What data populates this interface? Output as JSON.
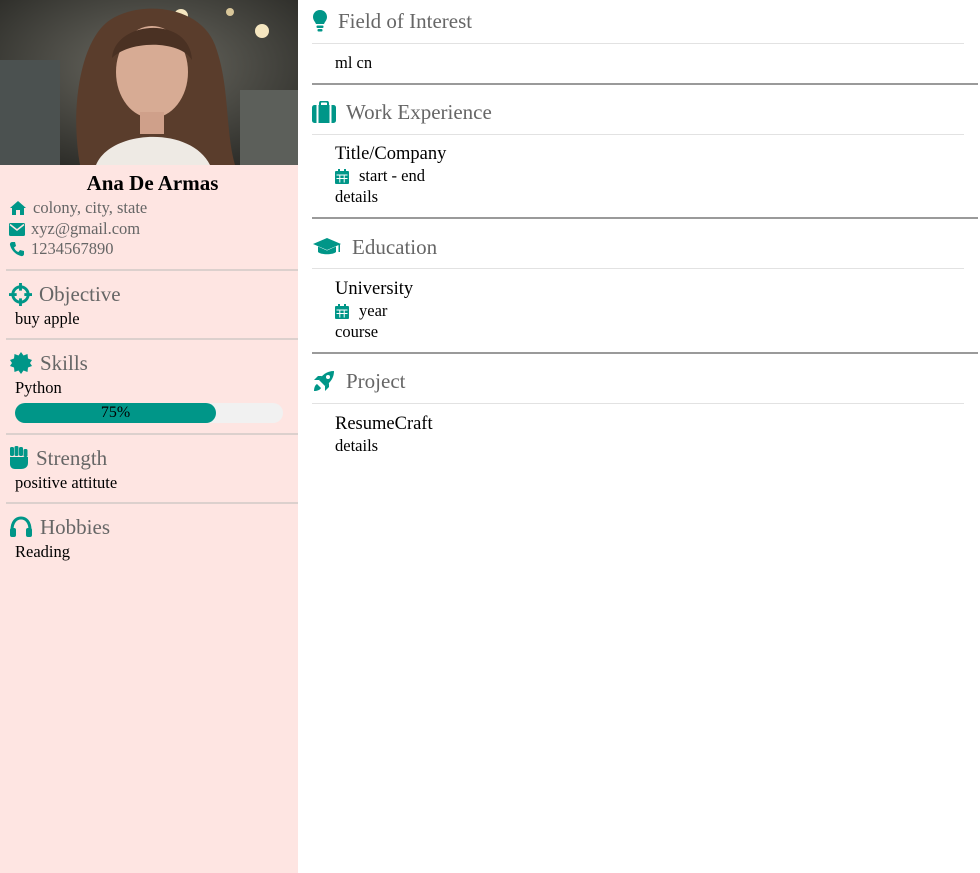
{
  "profile": {
    "name": "Ana De Armas",
    "address": "colony, city, state",
    "email": "xyz@gmail.com",
    "phone": "1234567890"
  },
  "sidebar": {
    "objective": {
      "title": "Objective",
      "text": "buy apple"
    },
    "skills": {
      "title": "Skills",
      "skill": "Python",
      "level_percent": 75,
      "level_label": "75%"
    },
    "strength": {
      "title": "Strength",
      "text": "positive attitute"
    },
    "hobbies": {
      "title": "Hobbies",
      "text": "Reading"
    }
  },
  "main": {
    "interest": {
      "title": "Field of Interest",
      "text": "ml cn"
    },
    "work": {
      "title": "Work Experience",
      "role": "Title/Company",
      "dates": "start - end",
      "details": "details"
    },
    "education": {
      "title": "Education",
      "school": "University",
      "year": "year",
      "course": "course"
    },
    "project": {
      "title": "Project",
      "name": "ResumeCraft",
      "details": "details"
    }
  },
  "colors": {
    "accent": "#009688",
    "sidebar_bg": "#fee5e2",
    "heading_gray": "#666666"
  },
  "icons": [
    "home-icon",
    "envelope-icon",
    "phone-icon",
    "crosshairs-icon",
    "certificate-icon",
    "fist-icon",
    "headphones-icon",
    "lightbulb-icon",
    "suitcase-icon",
    "graduation-cap-icon",
    "rocket-icon",
    "calendar-icon"
  ]
}
